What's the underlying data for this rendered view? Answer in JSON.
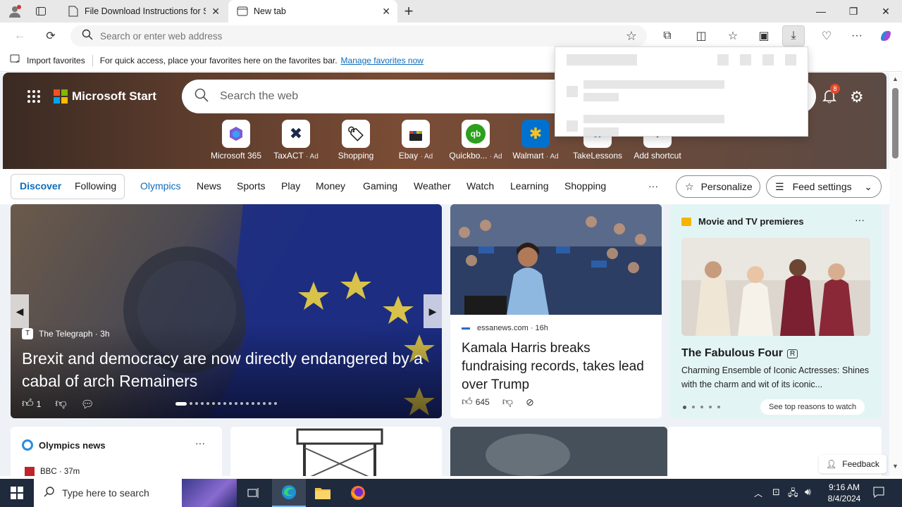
{
  "tabs": [
    {
      "label": "File Download Instructions for Sa",
      "active": false
    },
    {
      "label": "New tab",
      "active": true
    }
  ],
  "address": {
    "placeholder": "Search or enter web address"
  },
  "favorites_bar": {
    "import_label": "Import favorites",
    "hint": "For quick access, place your favorites here on the favorites bar.",
    "manage_link": "Manage favorites now"
  },
  "msn": {
    "brand": "Microsoft Start",
    "search_placeholder": "Search the web",
    "notification_count": "8",
    "quick_links": [
      {
        "label": "Microsoft 365",
        "ad": "",
        "icon": "microsoft-365-icon"
      },
      {
        "label": "TaxACT",
        "ad": "· Ad",
        "icon": "taxact-icon"
      },
      {
        "label": "Shopping",
        "ad": "",
        "icon": "shopping-tag-icon"
      },
      {
        "label": "Ebay",
        "ad": "· Ad",
        "icon": "ebay-icon"
      },
      {
        "label": "Quickbo...",
        "ad": "· Ad",
        "icon": "quickbooks-icon"
      },
      {
        "label": "Walmart",
        "ad": "· Ad",
        "icon": "walmart-icon"
      },
      {
        "label": "TakeLessons",
        "ad": "",
        "icon": "takelessons-icon"
      },
      {
        "label": "Add shortcut",
        "ad": "",
        "icon": "plus-icon"
      }
    ],
    "nav": {
      "discover": "Discover",
      "following": "Following",
      "items": [
        "Olympics",
        "News",
        "Sports",
        "Play",
        "Money",
        "Gaming",
        "Weather",
        "Watch",
        "Learning",
        "Shopping"
      ],
      "more": "···",
      "personalize": "Personalize",
      "feed_settings": "Feed settings"
    },
    "main_story": {
      "source": "The Telegraph",
      "age": "3h",
      "title": "Brexit and democracy are now directly endangered by a cabal of arch Remainers",
      "likes": "1"
    },
    "side_story": {
      "source": "essanews.com",
      "age": "16h",
      "title": "Kamala Harris breaks fundraising records, takes lead over Trump",
      "likes": "645"
    },
    "movie_card": {
      "header": "Movie and TV premieres",
      "title": "The Fabulous Four",
      "rating": "R",
      "desc": "Charming Ensemble of Iconic Actresses: Shines with the charm and wit of its iconic...",
      "cta": "See top reasons to watch"
    },
    "olympics_card": {
      "header": "Olympics news",
      "source": "BBC",
      "age": "37m"
    },
    "feedback": "Feedback"
  },
  "taskbar": {
    "search_placeholder": "Type here to search",
    "time": "9:16 AM",
    "date": "8/4/2024"
  },
  "colors": {
    "accent": "#0f6cbd",
    "taskbar": "#1f2a3c"
  }
}
